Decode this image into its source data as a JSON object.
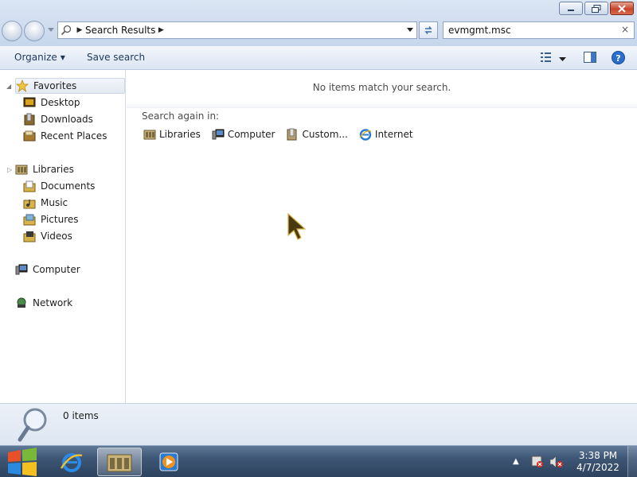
{
  "window": {
    "address": {
      "segments": [
        "Search Results"
      ]
    },
    "search": {
      "value": "evmgmt.msc",
      "clear_symbol": "×"
    }
  },
  "command_bar": {
    "organize_label": "Organize",
    "save_search_label": "Save search"
  },
  "navigation": {
    "favorites": {
      "label": "Favorites",
      "items": [
        {
          "label": "Desktop",
          "icon": "desktop-icon"
        },
        {
          "label": "Downloads",
          "icon": "downloads-icon"
        },
        {
          "label": "Recent Places",
          "icon": "recent-places-icon"
        }
      ]
    },
    "libraries": {
      "label": "Libraries",
      "items": [
        {
          "label": "Documents",
          "icon": "documents-icon"
        },
        {
          "label": "Music",
          "icon": "music-icon"
        },
        {
          "label": "Pictures",
          "icon": "pictures-icon"
        },
        {
          "label": "Videos",
          "icon": "videos-icon"
        }
      ]
    },
    "computer": {
      "label": "Computer"
    },
    "network": {
      "label": "Network"
    }
  },
  "content": {
    "empty_message": "No items match your search.",
    "search_again_label": "Search again in:",
    "search_again_links": [
      {
        "label": "Libraries",
        "icon": "libraries-icon"
      },
      {
        "label": "Computer",
        "icon": "computer-icon"
      },
      {
        "label": "Custom...",
        "icon": "custom-icon"
      },
      {
        "label": "Internet",
        "icon": "internet-explorer-icon"
      }
    ]
  },
  "details": {
    "item_count": "0 items"
  },
  "taskbar": {
    "clock": {
      "time": "3:38 PM",
      "date": "4/7/2022"
    }
  },
  "colors": {
    "frame": "#cfdcee",
    "taskbar": "#3e5675",
    "accent": "#1e395b"
  }
}
